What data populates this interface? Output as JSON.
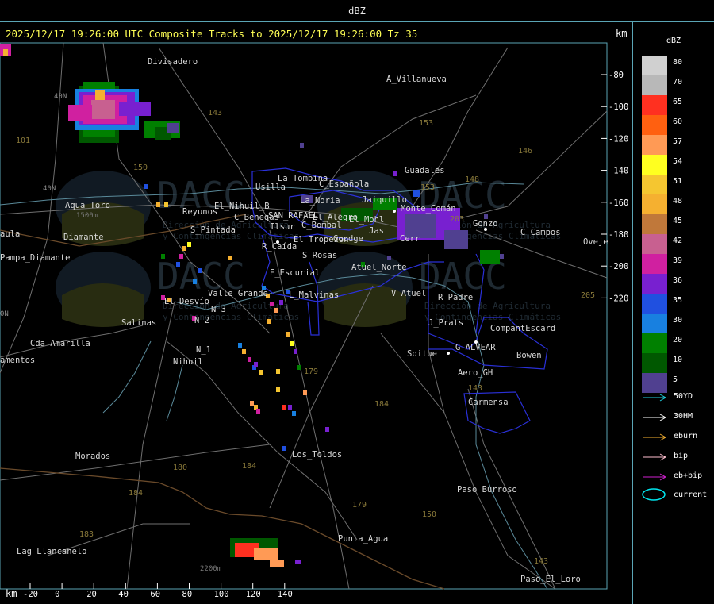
{
  "window": {
    "title": "dBZ"
  },
  "header": {
    "title": "2025/12/17 19:26:00 UTC Composite Tracks to 2025/12/17 19:26:00 Tz 35",
    "km_label": "km"
  },
  "map": {
    "y_axis_ticks": [
      "-80",
      "-100",
      "-120",
      "-140",
      "-160",
      "-180",
      "-200",
      "-220"
    ],
    "x_axis_ticks": [
      "-20",
      "0",
      "20",
      "40",
      "60",
      "80",
      "100",
      "120",
      "140"
    ],
    "x_axis_unit": "km",
    "watermark": {
      "logo": "DACC",
      "line1": "Dirección de Agricultura",
      "line2": "y Contingencias Climáticas"
    },
    "places": [
      {
        "name": "Divisadero"
      },
      {
        "name": "A_Villanueva"
      },
      {
        "name": "Guadales"
      },
      {
        "name": "La_Tombina"
      },
      {
        "name": "Usilla"
      },
      {
        "name": "C_Española"
      },
      {
        "name": "La_Noria"
      },
      {
        "name": "Aqua_Toro"
      },
      {
        "name": "Reyunos"
      },
      {
        "name": "El_Nihuil_B"
      },
      {
        "name": "C_Benegas"
      },
      {
        "name": "SAN_RAFAEL"
      },
      {
        "name": "El_Alegro"
      },
      {
        "name": "Ilsur"
      },
      {
        "name": "C_Bombal"
      },
      {
        "name": "El_Mohl"
      },
      {
        "name": "C_Campos"
      },
      {
        "name": "Goudge"
      },
      {
        "name": "Monte_Comán"
      },
      {
        "name": "Jaiquillo"
      },
      {
        "name": "Oveje"
      },
      {
        "name": "aula"
      },
      {
        "name": "Pampa_Diamante"
      },
      {
        "name": "S_Pintada"
      },
      {
        "name": "R_Caída"
      },
      {
        "name": "El_Tropezon"
      },
      {
        "name": "S_Rosas"
      },
      {
        "name": "Atuel_Norte"
      },
      {
        "name": "E_Escurial"
      },
      {
        "name": "Valle_Grande"
      },
      {
        "name": "L_Malvinas"
      },
      {
        "name": "V_Atuel"
      },
      {
        "name": "R_Padre"
      },
      {
        "name": "El_Desvío"
      },
      {
        "name": "J_Prats"
      },
      {
        "name": "CompantEscard"
      },
      {
        "name": "Salinas"
      },
      {
        "name": "N_2"
      },
      {
        "name": "N_3"
      },
      {
        "name": "N_1"
      },
      {
        "name": "Nihuil"
      },
      {
        "name": "G_ALVEAR"
      },
      {
        "name": "Bowen"
      },
      {
        "name": "Soitue"
      },
      {
        "name": "Cda_Amarilla"
      },
      {
        "name": "amentos"
      },
      {
        "name": "Aero_GH"
      },
      {
        "name": "Carmensa"
      },
      {
        "name": "Morados"
      },
      {
        "name": "Los_Toldos"
      },
      {
        "name": "Paso_Burroso"
      },
      {
        "name": "Punta_Agua"
      },
      {
        "name": "Lag_Llancanelo"
      },
      {
        "name": "Paso_El_Loro"
      },
      {
        "name": "Jas"
      },
      {
        "name": "Gonzo"
      },
      {
        "name": "Cerr"
      },
      {
        "name": "Diamante"
      }
    ],
    "route_numbers": [
      "143",
      "153",
      "146",
      "150",
      "148",
      "101",
      "203",
      "179",
      "184",
      "180",
      "153",
      "205",
      "143",
      "183",
      "143",
      "179",
      "150",
      "184",
      "184"
    ],
    "contour_labels": [
      "1500m",
      "2200m"
    ],
    "grid_labels": [
      "40N",
      "40N",
      "0N"
    ]
  },
  "legend": {
    "title": "dBZ",
    "scale": [
      {
        "value": "80",
        "color": "#d0d0d0"
      },
      {
        "value": "70",
        "color": "#b8b8b8"
      },
      {
        "value": "65",
        "color": "#ff3020"
      },
      {
        "value": "60",
        "color": "#ff6010"
      },
      {
        "value": "57",
        "color": "#ff9a55"
      },
      {
        "value": "54",
        "color": "#ffff20"
      },
      {
        "value": "51",
        "color": "#f5c630"
      },
      {
        "value": "48",
        "color": "#f5b030"
      },
      {
        "value": "45",
        "color": "#c0783a"
      },
      {
        "value": "42",
        "color": "#c86090"
      },
      {
        "value": "39",
        "color": "#d020a0"
      },
      {
        "value": "36",
        "color": "#7820d0"
      },
      {
        "value": "35",
        "color": "#2050e0"
      },
      {
        "value": "30",
        "color": "#1880e0"
      },
      {
        "value": "20",
        "color": "#008000"
      },
      {
        "value": "10",
        "color": "#005800"
      },
      {
        "value": "5",
        "color": "#504090"
      }
    ],
    "tracks": [
      {
        "label": "50YD",
        "color": "#20d0e0"
      },
      {
        "label": "30HM",
        "color": "#ffffff"
      },
      {
        "label": "eburn",
        "color": "#f5b030"
      },
      {
        "label": "bip",
        "color": "#ffc0d0"
      },
      {
        "label": "eb+bip",
        "color": "#d020d0"
      }
    ],
    "current_label": "current",
    "current_color": "#00e5ee"
  }
}
